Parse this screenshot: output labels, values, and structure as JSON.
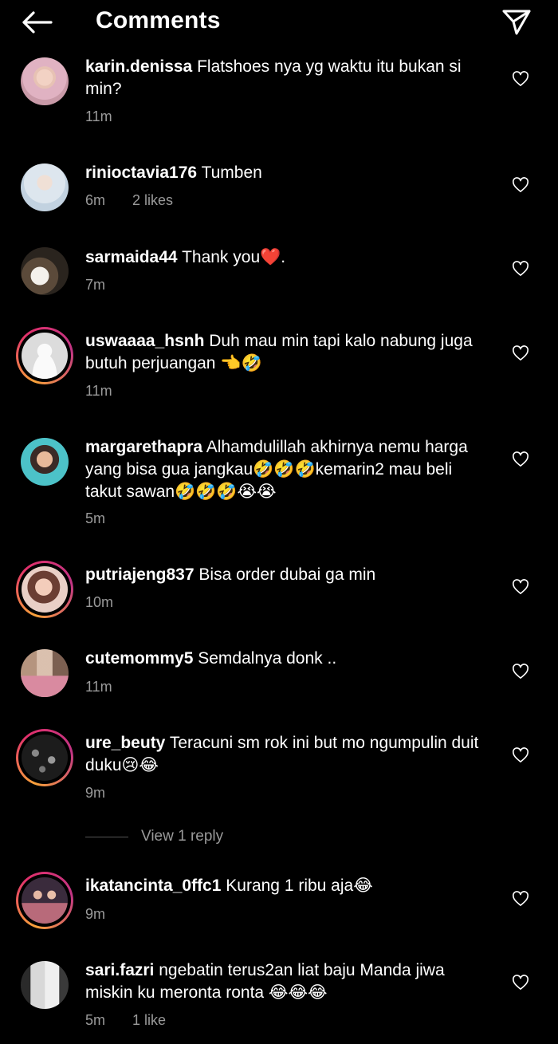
{
  "header": {
    "title": "Comments",
    "back_icon": "arrow-left-icon",
    "send_icon": "paper-plane-icon"
  },
  "comments": [
    {
      "username": "karin.denissa",
      "text": "Flatshoes nya yg waktu itu bukan si min?",
      "time": "11m",
      "likes": ""
    },
    {
      "username": "rinioctavia176",
      "text": "Tumben",
      "time": "6m",
      "likes": "2 likes"
    },
    {
      "username": "sarmaida44",
      "text": "Thank you❤️.",
      "time": "7m",
      "likes": ""
    },
    {
      "username": "uswaaaa_hsnh",
      "text": "Duh mau min tapi kalo nabung juga butuh perjuangan 👈🤣",
      "time": "11m",
      "likes": ""
    },
    {
      "username": "margarethapra",
      "text": "Alhamdulillah akhirnya nemu harga yang bisa gua jangkau🤣🤣🤣kemarin2 mau beli takut sawan🤣🤣🤣😭😭",
      "time": "5m",
      "likes": ""
    },
    {
      "username": "putriajeng837",
      "text": "Bisa order dubai ga min",
      "time": "10m",
      "likes": ""
    },
    {
      "username": "cutemommy5",
      "text": "Semdalnya donk ..",
      "time": "11m",
      "likes": ""
    },
    {
      "username": "ure_beuty",
      "text": "Teracuni sm rok ini but mo ngumpulin duit duku😢😂",
      "time": "9m",
      "likes": ""
    },
    {
      "username": "ikatancinta_0ffc1",
      "text": "Kurang 1 ribu aja😂",
      "time": "9m",
      "likes": ""
    },
    {
      "username": "sari.fazri",
      "text": "ngebatin terus2an liat baju Manda jiwa miskin ku meronta ronta 😂😂😂",
      "time": "5m",
      "likes": "1 like"
    }
  ],
  "view_reply": {
    "label": "View 1 reply"
  },
  "colors": {
    "background": "#000000",
    "text": "#ffffff",
    "meta": "#9a9a9a",
    "story_ring": "#e1306c"
  }
}
